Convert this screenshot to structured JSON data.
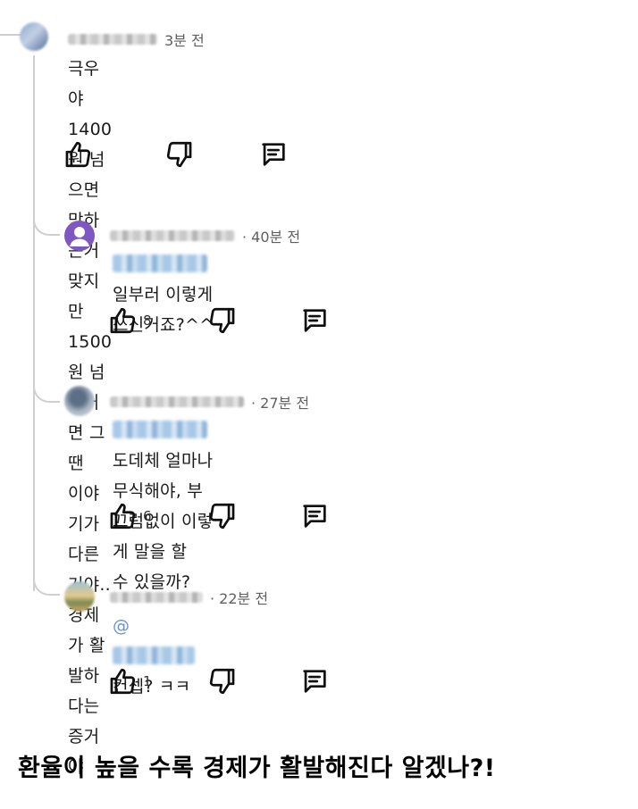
{
  "comments": [
    {
      "time": "3분 전",
      "text_line1": "극우야 1400원 넘으면 망하는거 맞지만 1500원 넘은거면 그땐",
      "text_line2": "이야기가 다른거야..경제가 활발하다는 증거야",
      "like_count": ""
    },
    {
      "time": "· 40분 전",
      "text": "일부러 이렇게 쓰신거죠?^^",
      "like_count": "8"
    },
    {
      "time": "· 27분 전",
      "text_line1": "도데체 얼마나 무식해야, 부끄럼없이 이렇게 말을 할",
      "text_line2": "수 있을까?",
      "like_count": "6"
    },
    {
      "time": "· 22분 전",
      "mention_prefix": "@",
      "text": "컨셉? ㅋㅋ",
      "like_count": "1"
    }
  ],
  "caption": "환율이 높을 수록 경제가 활발해진다 알겠나?!",
  "colors": {
    "thread_line": "#cfcfcf",
    "text": "#1a1a1a",
    "meta": "#606060"
  },
  "icons": [
    "thumbs-up-icon",
    "thumbs-down-icon",
    "reply-icon"
  ]
}
